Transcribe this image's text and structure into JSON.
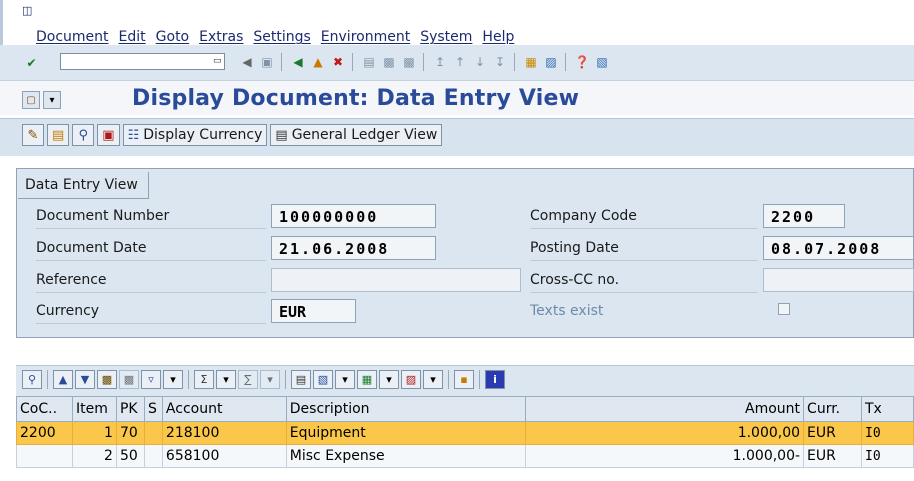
{
  "menu": [
    "Document",
    "Edit",
    "Goto",
    "Extras",
    "Settings",
    "Environment",
    "System",
    "Help"
  ],
  "page_title": "Display Document: Data Entry View",
  "app_toolbar": {
    "display_currency": "Display Currency",
    "general_ledger_view": "General Ledger View"
  },
  "frame_title": "Data Entry View",
  "header": {
    "document_number_label": "Document Number",
    "document_number": "100000000",
    "company_code_label": "Company Code",
    "company_code": "2200",
    "document_date_label": "Document Date",
    "document_date": "21.06.2008",
    "posting_date_label": "Posting Date",
    "posting_date": "08.07.2008",
    "reference_label": "Reference",
    "reference": "",
    "cross_cc_label": "Cross-CC no.",
    "cross_cc": "",
    "currency_label": "Currency",
    "currency": "EUR",
    "texts_exist_label": "Texts exist",
    "texts_exist": false
  },
  "table": {
    "columns": [
      "CoC..",
      "Item",
      "PK",
      "S",
      "Account",
      "Description",
      "Amount",
      "Curr.",
      "Tx"
    ],
    "rows": [
      [
        "2200",
        "1",
        "70",
        "",
        "218100",
        "Equipment",
        "1.000,00",
        "EUR",
        "I0"
      ],
      [
        "",
        "2",
        "50",
        "",
        "658100",
        "Misc Expense",
        "1.000,00-",
        "EUR",
        "I0"
      ]
    ]
  },
  "colors": {
    "title_blue": "#2a4a9a",
    "selected_row": "#fbc74a",
    "panel_bg": "#dbe6f0"
  }
}
